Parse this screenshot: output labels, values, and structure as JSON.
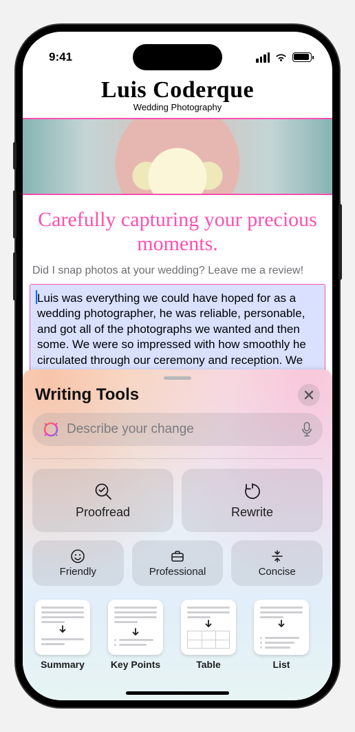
{
  "status": {
    "time": "9:41"
  },
  "page": {
    "brand": "Luis Coderque",
    "brand_sub": "Wedding Photography",
    "headline": "Carefully capturing your precious moments.",
    "prompt": "Did I snap photos at your wedding? Leave me a review!",
    "review_text": "Luis was everything we could have hoped for as a wedding photographer, he was reliable, personable, and got all of the photographs we wanted and then some. We were so impressed with how smoothly he circulated through our ceremony and reception. We barely realized he was there except when he was very"
  },
  "panel": {
    "title": "Writing Tools",
    "placeholder": "Describe your change",
    "proofread": "Proofread",
    "rewrite": "Rewrite",
    "friendly": "Friendly",
    "professional": "Professional",
    "concise": "Concise",
    "summary": "Summary",
    "keypoints": "Key Points",
    "table": "Table",
    "list": "List"
  }
}
